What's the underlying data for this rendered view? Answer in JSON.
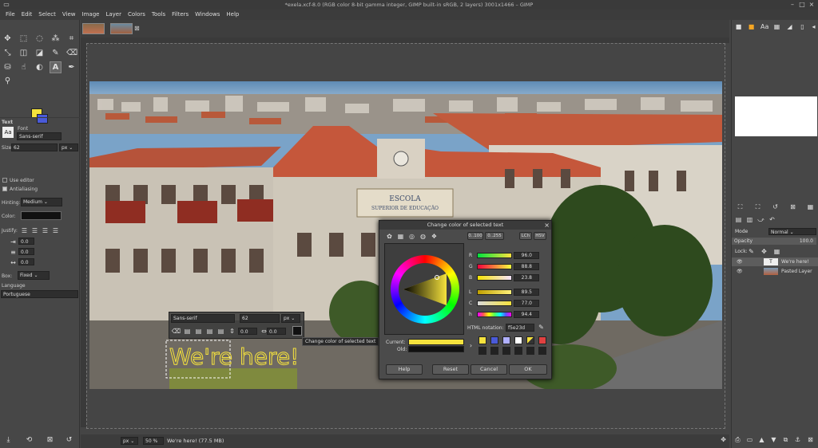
{
  "window": {
    "title": "*exela.xcf-8.0 (RGB color 8-bit gamma integer, GIMP built-in sRGB, 2 layers) 3001x1466 – GIMP"
  },
  "menu": [
    "File",
    "Edit",
    "Select",
    "View",
    "Image",
    "Layer",
    "Colors",
    "Tools",
    "Filters",
    "Windows",
    "Help"
  ],
  "colors": {
    "foreground": "#f5e23d",
    "background": "#4a5ad8"
  },
  "tool_options": {
    "section": "Text",
    "font_label": "Font",
    "font_value": "Sans-serif",
    "size_label": "Size:",
    "size_value": "62",
    "size_unit": "px",
    "use_editor": "Use editor",
    "antialiasing": "Antialiasing",
    "hinting_label": "Hinting:",
    "hinting_value": "Medium",
    "color_label": "Color:",
    "justify_label": "Justify:",
    "indent": "0.0",
    "line_spacing": "0.0",
    "letter_spacing": "0.0",
    "box_label": "Box:",
    "box_value": "Fixed",
    "language_label": "Language",
    "language_value": "Portuguese"
  },
  "text_toolbar": {
    "font": "Sans-serif",
    "size": "62",
    "unit": "px",
    "baseline": "0.0",
    "kerning": "0.0",
    "tooltip": "Change color of selected text"
  },
  "canvas_text": "We're here!",
  "photo_sign": [
    "ESCOLA",
    "SUPERIOR DE EDUCAÇÃO"
  ],
  "color_dialog": {
    "title": "Change color of selected text",
    "range_a": "0..100",
    "range_b": "0..255",
    "mode_a": "LCh",
    "mode_b": "HSV",
    "channels": [
      {
        "label": "R",
        "value": "96.0"
      },
      {
        "label": "G",
        "value": "88.8"
      },
      {
        "label": "B",
        "value": "23.8"
      },
      {
        "label": "L",
        "value": "89.5"
      },
      {
        "label": "C",
        "value": "77.0"
      },
      {
        "label": "h",
        "value": "94.4"
      }
    ],
    "html_label": "HTML notation:",
    "html_value": "f5e23d",
    "current_label": "Current:",
    "old_label": "Old:",
    "history": [
      "#f5e23d",
      "#4a5ad8",
      "#b0b0ff",
      "#ffffff",
      "#f5e23d",
      "#e04040",
      "#222222",
      "#222222",
      "#222222",
      "#222222",
      "#222222",
      "#222222"
    ],
    "buttons": {
      "help": "Help",
      "reset": "Reset",
      "cancel": "Cancel",
      "ok": "OK"
    }
  },
  "layers": {
    "mode_label": "Mode",
    "mode_value": "Normal",
    "opacity_label": "Opacity",
    "opacity_value": "100.0",
    "lock_label": "Lock:",
    "items": [
      {
        "name": "We're here!"
      },
      {
        "name": "Pasted Layer"
      }
    ]
  },
  "status": {
    "unit": "px",
    "zoom": "50 %",
    "message": "We're here! (77.5 MB)"
  }
}
